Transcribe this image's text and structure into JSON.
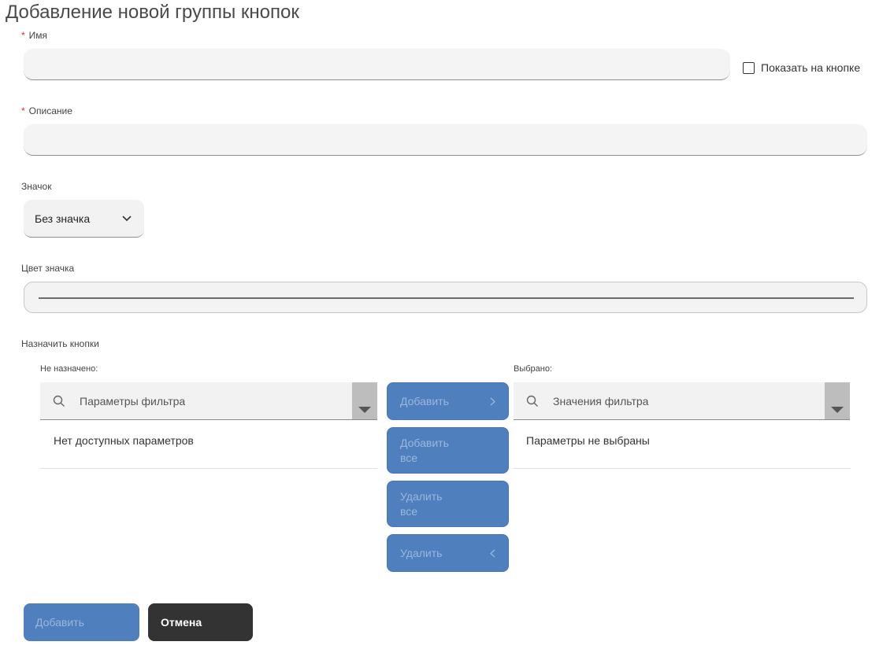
{
  "dialog": {
    "title": "Добавление новой группы кнопок"
  },
  "name_field": {
    "required_mark": "*",
    "label": "Имя",
    "value": "",
    "placeholder": ""
  },
  "show_on_button": {
    "label": "Показать на кнопке",
    "checked": false
  },
  "description_field": {
    "required_mark": "*",
    "label": "Описание",
    "value": "",
    "placeholder": ""
  },
  "icon_field": {
    "label": "Значок",
    "selected": "Без значка"
  },
  "icon_color_field": {
    "label": "Цвет значка"
  },
  "assign_buttons": {
    "label": "Назначить кнопки",
    "unassigned": {
      "label": "Не назначено:",
      "filter_placeholder": "Параметры фильтра",
      "empty_text": "Нет доступных параметров"
    },
    "selected": {
      "label": "Выбрано:",
      "filter_placeholder": "Значения фильтра",
      "empty_text": "Параметры не выбраны"
    },
    "transfer_buttons": {
      "add": "Добавить",
      "add_all_line1": "Добавить",
      "add_all_line2": "все",
      "remove_all_line1": "Удалить",
      "remove_all_line2": "все",
      "remove": "Удалить"
    }
  },
  "footer": {
    "submit": "Добавить",
    "cancel": "Отмена"
  },
  "colors": {
    "accent": "#4f7fbd",
    "dark_button": "#333333",
    "required": "#d9362b"
  }
}
